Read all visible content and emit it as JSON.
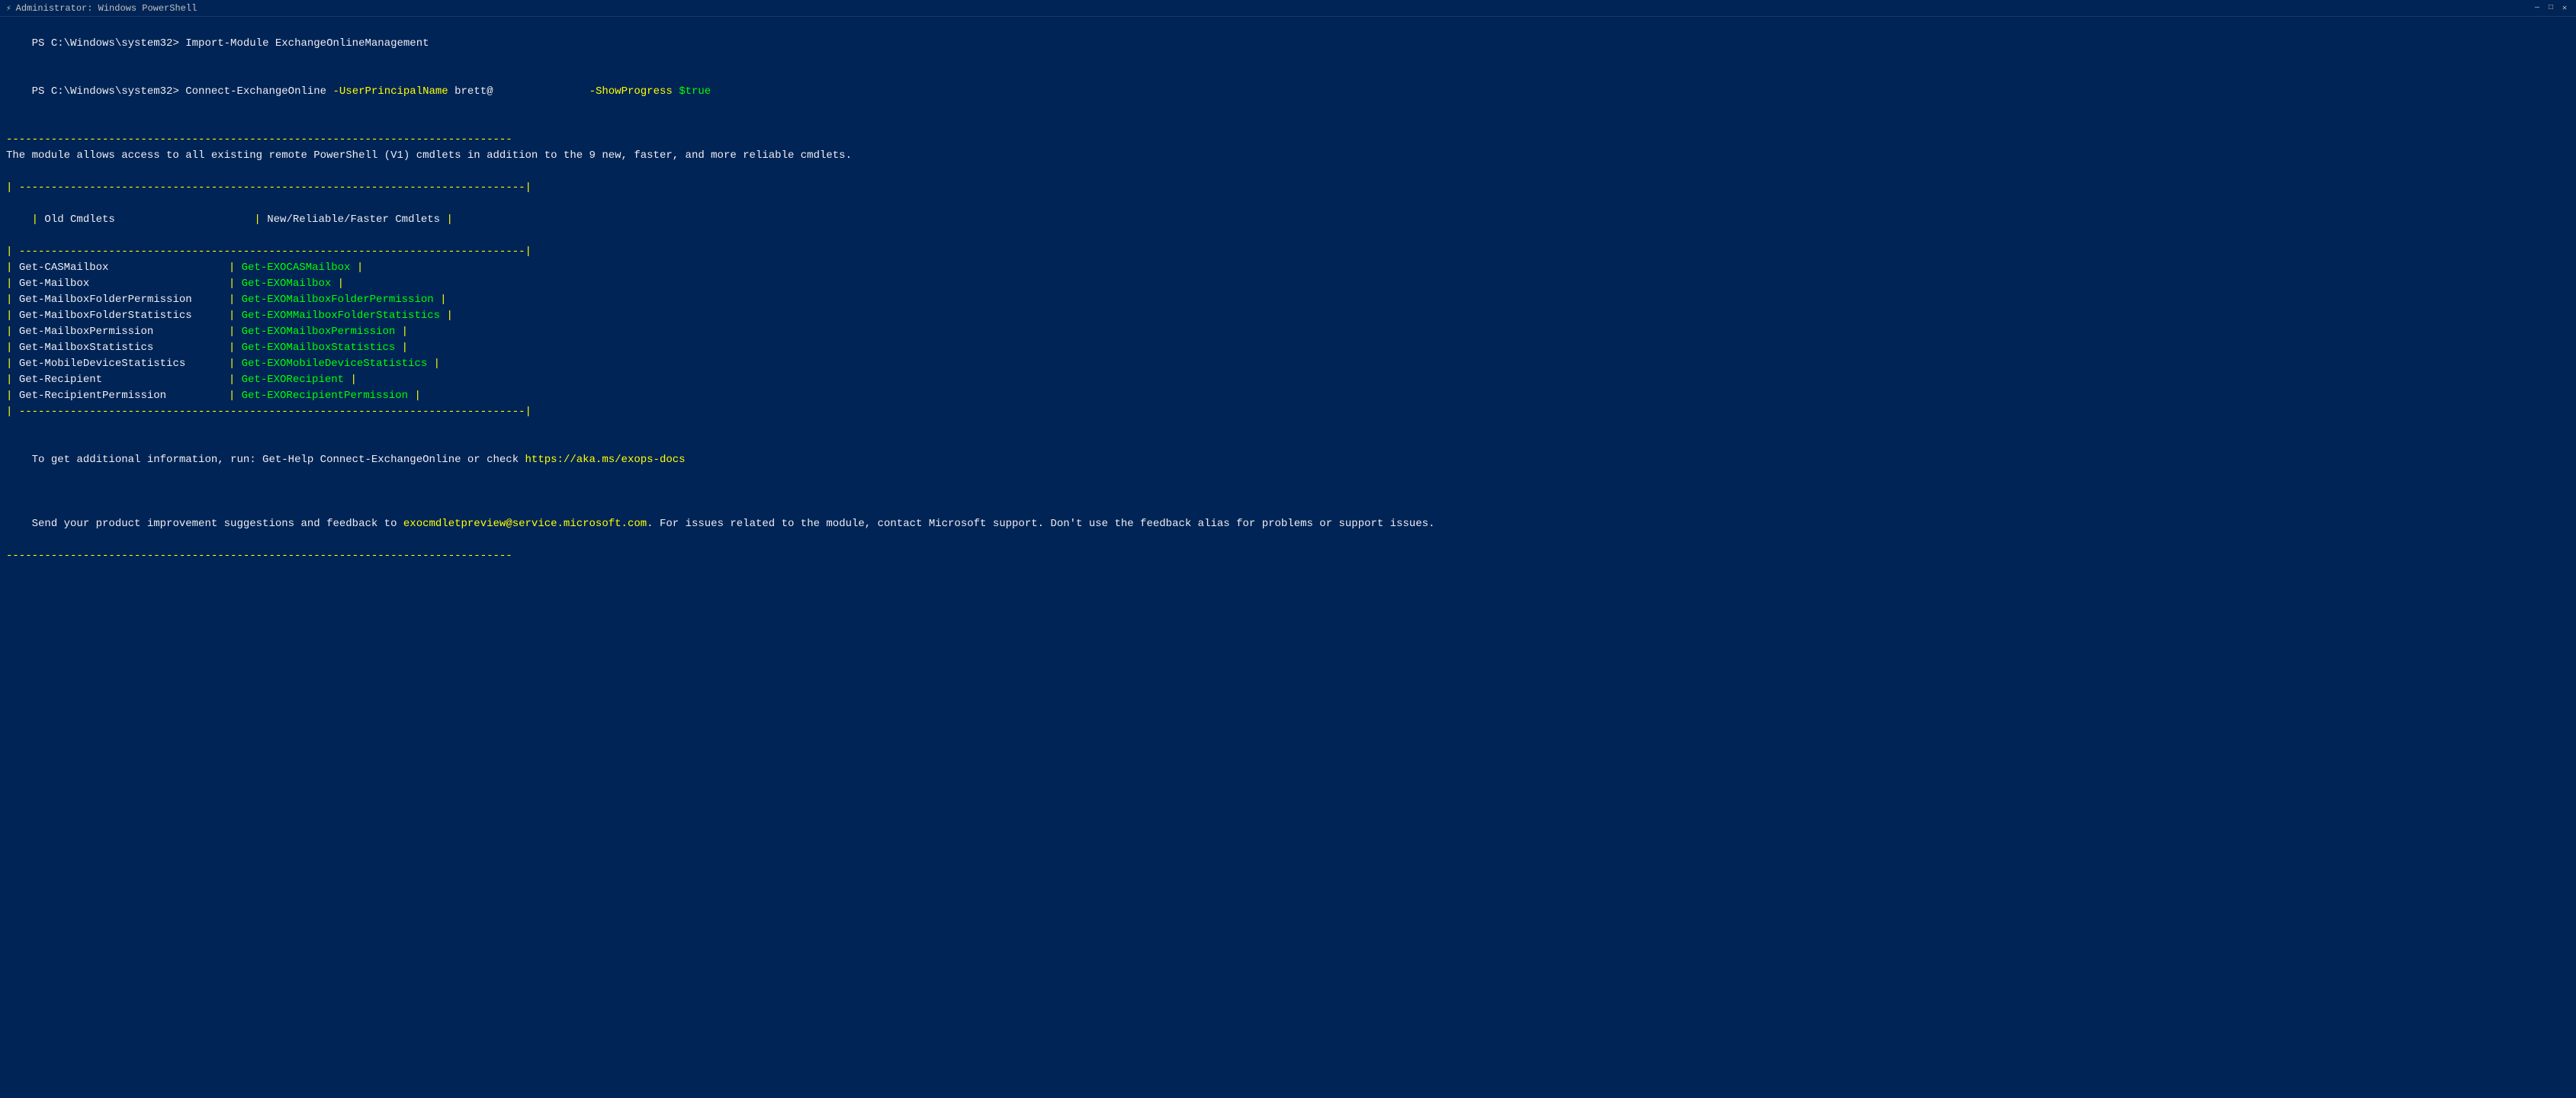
{
  "titleBar": {
    "title": "Administrator: Windows PowerShell",
    "minimizeLabel": "—",
    "maximizeLabel": "□",
    "closeLabel": "✕"
  },
  "terminal": {
    "line1_prompt": "PS C:\\Windows\\system32> ",
    "line1_cmd": "Import-Module ExchangeOnlineManagement",
    "line2_prompt": "PS C:\\Windows\\system32> ",
    "line2_cmd": "Connect-ExchangeOnline ",
    "line2_param": "-UserPrincipalName ",
    "line2_value": "brett@",
    "line2_param2": "               -ShowProgress ",
    "line2_bool": "$true",
    "divider1": "-------------------------------------------------------------------------------",
    "moduleInfo": "The module allows access to all existing remote PowerShell (V1) cmdlets in addition to the 9 new, faster, and more reliable cmdlets.",
    "divider2": "-------------------------------------------------------------------------------",
    "tableHeader_old": "Old Cmdlets",
    "tableHeader_new": "New/Reliable/Faster Cmdlets",
    "divider3": "-------------------------------------------------------------------------------",
    "tableRows": [
      {
        "old": "Get-CASMailbox",
        "new": "Get-EXOCASMailbox"
      },
      {
        "old": "Get-Mailbox",
        "new": "Get-EXOMailbox"
      },
      {
        "old": "Get-MailboxFolderPermission",
        "new": "Get-EXOMailboxFolderPermission"
      },
      {
        "old": "Get-MailboxFolderStatistics",
        "new": "Get-EXOMMailboxFolderStatistics"
      },
      {
        "old": "Get-MailboxPermission",
        "new": "Get-EXOMailboxPermission"
      },
      {
        "old": "Get-MailboxStatistics",
        "new": "Get-EXOMailboxStatistics"
      },
      {
        "old": "Get-MobileDeviceStatistics",
        "new": "Get-EXOMobileDeviceStatistics"
      },
      {
        "old": "Get-Recipient",
        "new": "Get-EXORecipient"
      },
      {
        "old": "Get-RecipientPermission",
        "new": "Get-EXORecipientPermission"
      }
    ],
    "divider4": "-------------------------------------------------------------------------------",
    "additionalInfo": "To get additional information, run: Get-Help Connect-ExchangeOnline or check ",
    "link": "https://aka.ms/exops-docs",
    "feedbackLine": "Send your product improvement suggestions and feedback to ",
    "email": "exocmdletpreview@service.microsoft.com",
    "feedbackRest": ". For issues related to the module, contact Microsoft support. Don't use the feedback alias for problems or support issues.",
    "divider5": "-------------------------------------------------------------------------------"
  }
}
